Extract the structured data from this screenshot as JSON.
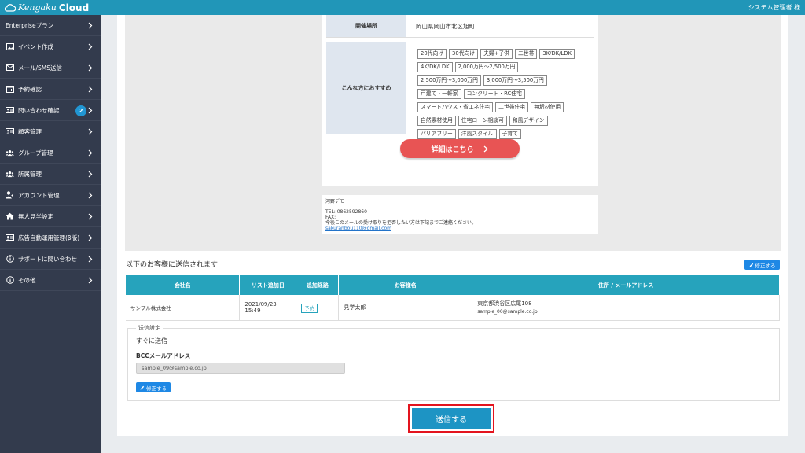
{
  "header": {
    "logo_prefix": "Kengaku",
    "logo_brand": "Cloud",
    "user": "システム管理者 様"
  },
  "sidebar": {
    "items": [
      {
        "label": "Enterpriseプラン",
        "icon": "none"
      },
      {
        "label": "イベント作成",
        "icon": "image-icon"
      },
      {
        "label": "メール/SMS送信",
        "icon": "mail-icon"
      },
      {
        "label": "予約確認",
        "icon": "calendar-icon"
      },
      {
        "label": "問い合わせ確認",
        "icon": "id-card-icon",
        "badge": "2"
      },
      {
        "label": "顧客管理",
        "icon": "id-card-icon"
      },
      {
        "label": "グループ管理",
        "icon": "group-icon"
      },
      {
        "label": "所属管理",
        "icon": "group-icon"
      },
      {
        "label": "アカウント管理",
        "icon": "user-admin-icon"
      },
      {
        "label": "無人見学設定",
        "icon": "home-icon"
      },
      {
        "label": "広告自動運用管理(β版)",
        "icon": "id-card-icon"
      },
      {
        "label": "サポートに問い合わせ",
        "icon": "info-icon"
      },
      {
        "label": "その他",
        "icon": "info-icon"
      }
    ]
  },
  "preview": {
    "location_label": "開催場所",
    "location_value": "岡山県岡山市北区旭町",
    "recommend_label": "こんな方におすすめ",
    "tags": [
      "20代向け",
      "30代向け",
      "夫婦+子供",
      "二世帯",
      "3K/DK/LDK",
      "4K/DK/LDK",
      "2,000万円〜2,500万円",
      "2,500万円〜3,000万円",
      "3,000万円〜3,500万円",
      "戸建て・一軒家",
      "コンクリート・RC住宅",
      "スマートハウス・省エネ住宅",
      "二世帯住宅",
      "無垢材使用",
      "自然素材使用",
      "住宅ローン相談可",
      "和風デザイン",
      "バリアフリー",
      "洋風スタイル",
      "子育て"
    ],
    "detail_button": "詳細はこちら",
    "signature": {
      "name": "河野デモ",
      "tel": "TEL: 0862592860",
      "fax": "FAX:",
      "note": "今後このメールの受け取りを拒否したい方は下記までご連絡ください。",
      "email": "sakuranbou110@gmail.com"
    }
  },
  "recipients": {
    "title": "以下のお客様に送信されます",
    "edit_label": "修正する",
    "columns": [
      "会社名",
      "リスト追加日",
      "追加経路",
      "お客様名",
      "住所 / メールアドレス"
    ],
    "rows": [
      {
        "company": "サンプル株式会社",
        "date": "2021/09/23",
        "time": "15:49",
        "route": "予約",
        "name": "見学太郎",
        "address": "東京都渋谷区広尾108",
        "email": "sample_00@sample.co.jp"
      }
    ]
  },
  "settings": {
    "legend": "送信設定",
    "timing": "すぐに送信",
    "bcc_label": "BCCメールアドレス",
    "bcc_value": "sample_09@sample.co.jp",
    "edit_label": "修正する"
  },
  "send_button": "送信する",
  "colors": {
    "topbar": "#2196b8",
    "sidebar": "#333b4d",
    "table_header": "#26a3bc",
    "detail_button": "#e85454",
    "send_button": "#1d94c4",
    "highlight": "#e3141e"
  }
}
